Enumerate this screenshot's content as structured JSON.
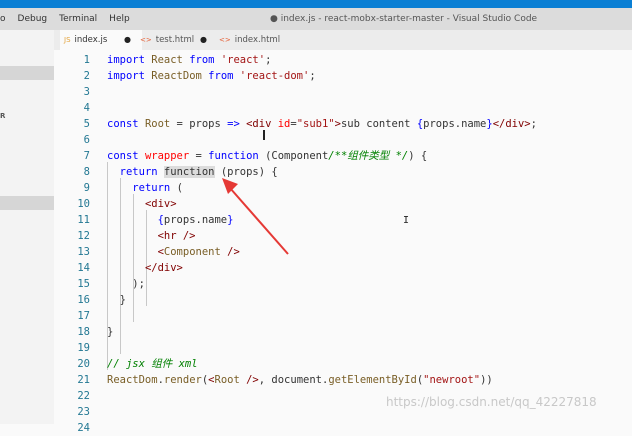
{
  "menu": {
    "items": [
      "o",
      "Debug",
      "Terminal",
      "Help"
    ]
  },
  "window": {
    "title": "● index.js - react-mobx-starter-master - Visual Studio Code"
  },
  "sidebar": {
    "label": "R"
  },
  "tabs": [
    {
      "label": "index.js",
      "modified": "●",
      "icon": "js-file-icon"
    },
    {
      "label": "test.html",
      "modified": "●",
      "icon": "html-file-icon"
    },
    {
      "label": "index.html",
      "modified": "",
      "icon": "html-file-icon"
    }
  ],
  "editor": {
    "lines": [
      {
        "n": "1",
        "tokens": [
          [
            "kw",
            "import "
          ],
          [
            "var",
            "React "
          ],
          [
            "kw",
            "from "
          ],
          [
            "str",
            "'react'"
          ],
          [
            "txt",
            ";"
          ]
        ]
      },
      {
        "n": "2",
        "tokens": [
          [
            "kw",
            "import "
          ],
          [
            "var",
            "ReactDom "
          ],
          [
            "kw",
            "from "
          ],
          [
            "str",
            "'react-dom'"
          ],
          [
            "txt",
            ";"
          ]
        ]
      },
      {
        "n": "3",
        "tokens": []
      },
      {
        "n": "4",
        "tokens": []
      },
      {
        "n": "5",
        "tokens": [
          [
            "kw",
            "const "
          ],
          [
            "var",
            "Root "
          ],
          [
            "txt",
            "= "
          ],
          [
            "txt",
            "props "
          ],
          [
            "kw",
            "=> "
          ],
          [
            "tag",
            "<div "
          ],
          [
            "attr",
            "id"
          ],
          [
            "txt",
            "="
          ],
          [
            "str",
            "\"sub1\""
          ],
          [
            "tag",
            ">"
          ],
          [
            "txt",
            "sub content "
          ],
          [
            "kw",
            "{"
          ],
          [
            "txt",
            "props.name"
          ],
          [
            "kw",
            "}"
          ],
          [
            "tag",
            "</div>"
          ],
          [
            "txt",
            ";"
          ]
        ]
      },
      {
        "n": "6",
        "tokens": []
      },
      {
        "n": "7",
        "tokens": [
          [
            "kw",
            "const "
          ],
          [
            "attr",
            "wrapper "
          ],
          [
            "txt",
            "= "
          ],
          [
            "kw",
            "function "
          ],
          [
            "txt",
            "(Component"
          ],
          [
            "com",
            "/**组件类型 */"
          ],
          [
            "txt",
            ") {"
          ]
        ]
      },
      {
        "n": "8",
        "tokens": [
          [
            "txt",
            "  "
          ],
          [
            "kw",
            "return "
          ],
          [
            "hl",
            "function"
          ],
          [
            "txt",
            " (props) {"
          ]
        ]
      },
      {
        "n": "9",
        "tokens": [
          [
            "txt",
            "    "
          ],
          [
            "kw",
            "return "
          ],
          [
            "txt",
            "("
          ]
        ]
      },
      {
        "n": "10",
        "tokens": [
          [
            "txt",
            "      "
          ],
          [
            "tag",
            "<div>"
          ]
        ]
      },
      {
        "n": "11",
        "tokens": [
          [
            "txt",
            "        "
          ],
          [
            "kw",
            "{"
          ],
          [
            "txt",
            "props.name"
          ],
          [
            "kw",
            "}"
          ]
        ]
      },
      {
        "n": "12",
        "tokens": [
          [
            "txt",
            "        "
          ],
          [
            "tag",
            "<hr />"
          ]
        ]
      },
      {
        "n": "13",
        "tokens": [
          [
            "txt",
            "        "
          ],
          [
            "tag",
            "<"
          ],
          [
            "var",
            "Component"
          ],
          [
            "tag",
            " />"
          ]
        ]
      },
      {
        "n": "14",
        "tokens": [
          [
            "txt",
            "      "
          ],
          [
            "tag",
            "</div>"
          ]
        ]
      },
      {
        "n": "15",
        "tokens": [
          [
            "txt",
            "    );"
          ]
        ]
      },
      {
        "n": "16",
        "tokens": [
          [
            "txt",
            "  }"
          ]
        ]
      },
      {
        "n": "17",
        "tokens": []
      },
      {
        "n": "18",
        "tokens": [
          [
            "txt",
            "}"
          ]
        ]
      },
      {
        "n": "19",
        "tokens": []
      },
      {
        "n": "20",
        "tokens": [
          [
            "com",
            "// jsx 组件 xml"
          ]
        ]
      },
      {
        "n": "21",
        "tokens": [
          [
            "var",
            "ReactDom"
          ],
          [
            "txt",
            "."
          ],
          [
            "fn",
            "render"
          ],
          [
            "txt",
            "("
          ],
          [
            "tag",
            "<"
          ],
          [
            "var",
            "Root "
          ],
          [
            "tag",
            "/>"
          ],
          [
            "txt",
            ", document."
          ],
          [
            "fn",
            "getElementById"
          ],
          [
            "txt",
            "("
          ],
          [
            "str",
            "\"newroot\""
          ],
          [
            "txt",
            "))"
          ]
        ]
      },
      {
        "n": "22",
        "tokens": []
      },
      {
        "n": "23",
        "tokens": []
      },
      {
        "n": "24",
        "tokens": []
      }
    ]
  },
  "annotation": {
    "color": "#e53935"
  },
  "watermark": {
    "text": "https://blog.csdn.net/qq_42227818"
  }
}
